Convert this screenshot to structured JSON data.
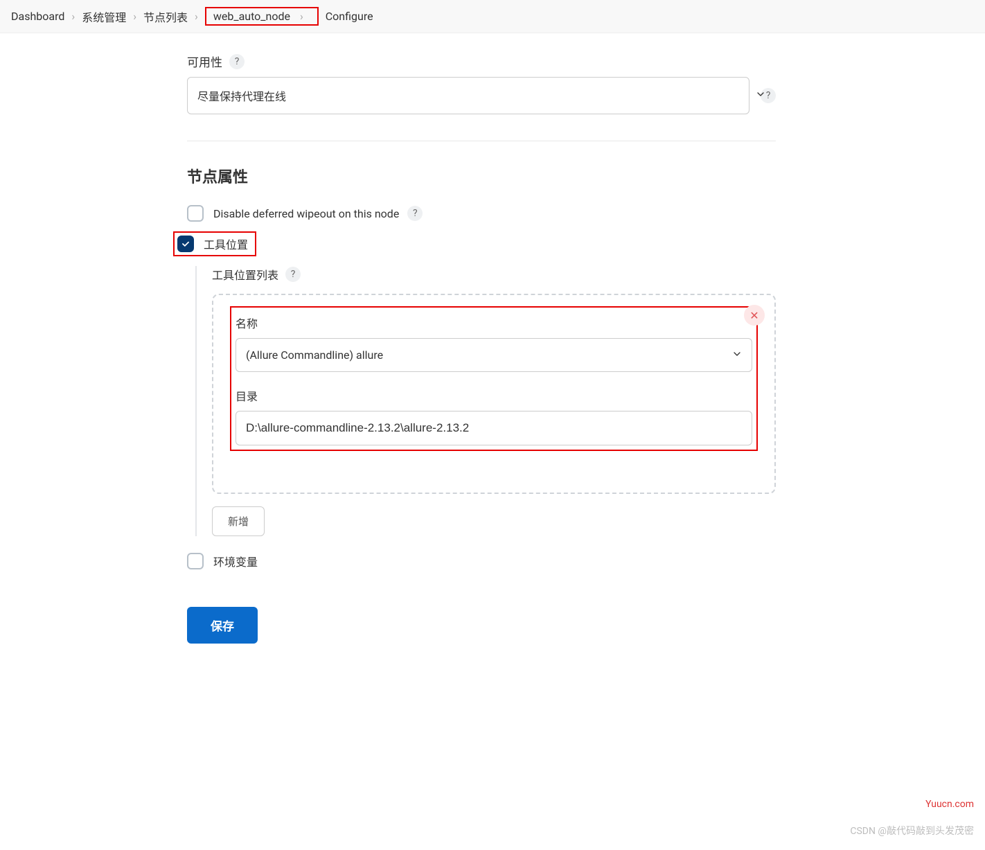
{
  "breadcrumb": {
    "items": [
      "Dashboard",
      "系统管理",
      "节点列表",
      "web_auto_node",
      "Configure"
    ]
  },
  "availability": {
    "label": "可用性",
    "value": "尽量保持代理在线"
  },
  "section": {
    "title": "节点属性",
    "disable_wipeout": {
      "label": "Disable deferred wipeout on this node",
      "checked": false
    },
    "tool_locations": {
      "label": "工具位置",
      "checked": true,
      "list_label": "工具位置列表",
      "entry": {
        "name_label": "名称",
        "name_value": "(Allure Commandline) allure",
        "dir_label": "目录",
        "dir_value": "D:\\allure-commandline-2.13.2\\allure-2.13.2"
      },
      "add_button": "新增"
    },
    "env_vars": {
      "label": "环境变量",
      "checked": false
    }
  },
  "buttons": {
    "save": "保存"
  },
  "watermarks": {
    "site": "Yuucn.com",
    "csdn": "CSDN @敲代码敲到头发茂密"
  }
}
